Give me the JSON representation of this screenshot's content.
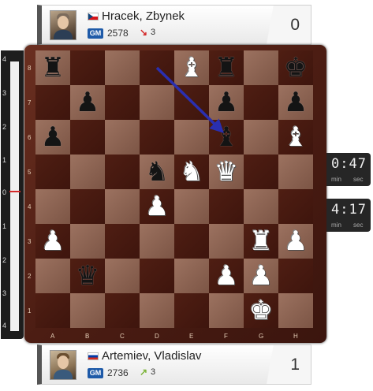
{
  "top_player": {
    "name": "Hracek, Zbynek",
    "title": "GM",
    "rating": "2578",
    "rating_change": "3",
    "trend": "down",
    "flag": "cz-flag-icon",
    "score": "0"
  },
  "bottom_player": {
    "name": "Artemiev, Vladislav",
    "title": "GM",
    "rating": "2736",
    "rating_change": "3",
    "trend": "up",
    "flag": "ru-flag-icon",
    "score": "1"
  },
  "eval_bar": {
    "ticks": [
      "4",
      "3",
      "2",
      "1",
      "0",
      "1",
      "2",
      "3",
      "4"
    ],
    "value": 0
  },
  "clocks": [
    {
      "time": "0:47",
      "min_label": "min",
      "sec_label": "sec"
    },
    {
      "time": "4:17",
      "min_label": "min",
      "sec_label": "sec"
    }
  ],
  "board": {
    "files": [
      "A",
      "B",
      "C",
      "D",
      "E",
      "F",
      "G",
      "H"
    ],
    "ranks": [
      "8",
      "7",
      "6",
      "5",
      "4",
      "3",
      "2",
      "1"
    ],
    "pieces": [
      {
        "square": "a8",
        "piece": "rook",
        "color": "black"
      },
      {
        "square": "e8",
        "piece": "bishop",
        "color": "white"
      },
      {
        "square": "f8",
        "piece": "rook",
        "color": "black"
      },
      {
        "square": "h8",
        "piece": "king",
        "color": "black"
      },
      {
        "square": "b7",
        "piece": "pawn",
        "color": "black"
      },
      {
        "square": "f7",
        "piece": "pawn",
        "color": "black"
      },
      {
        "square": "h7",
        "piece": "pawn",
        "color": "black"
      },
      {
        "square": "a6",
        "piece": "pawn",
        "color": "black"
      },
      {
        "square": "f6",
        "piece": "bishop",
        "color": "black"
      },
      {
        "square": "h6",
        "piece": "bishop",
        "color": "white"
      },
      {
        "square": "d5",
        "piece": "knight",
        "color": "black"
      },
      {
        "square": "e5",
        "piece": "knight",
        "color": "white"
      },
      {
        "square": "f5",
        "piece": "queen",
        "color": "white"
      },
      {
        "square": "d4",
        "piece": "pawn",
        "color": "white"
      },
      {
        "square": "a3",
        "piece": "pawn",
        "color": "white"
      },
      {
        "square": "g3",
        "piece": "rook",
        "color": "white"
      },
      {
        "square": "h3",
        "piece": "pawn",
        "color": "white"
      },
      {
        "square": "b2",
        "piece": "queen",
        "color": "black"
      },
      {
        "square": "f2",
        "piece": "pawn",
        "color": "white"
      },
      {
        "square": "g2",
        "piece": "pawn",
        "color": "white"
      },
      {
        "square": "g1",
        "piece": "king",
        "color": "white"
      }
    ],
    "arrow": {
      "from": "d8",
      "to": "f6",
      "color": "#2a2fb0"
    }
  },
  "colors": {
    "light_square": "#8f6453",
    "dark_square": "#46190f",
    "frame": "#5a2418",
    "arrow": "#2a2fb0"
  }
}
